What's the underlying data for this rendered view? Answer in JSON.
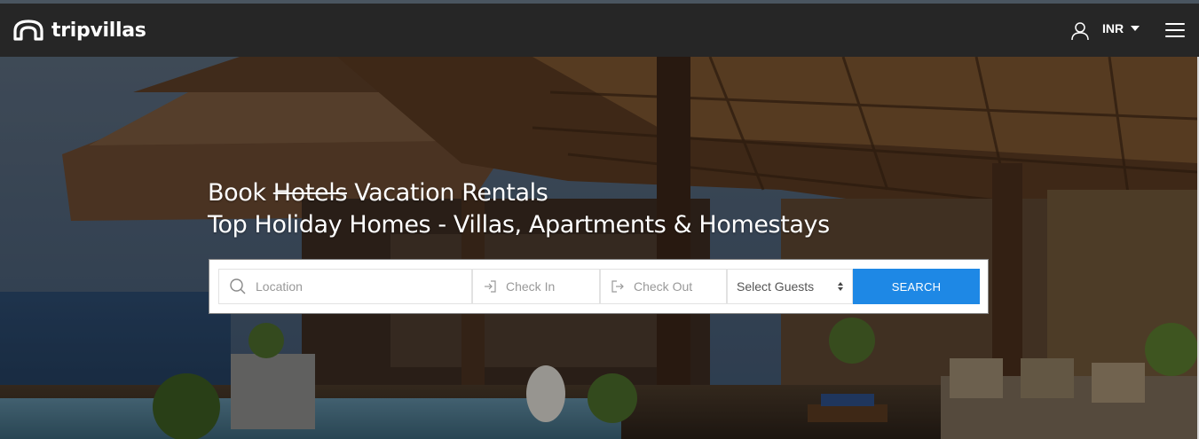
{
  "header": {
    "brand": "tripvillas",
    "currency": "INR"
  },
  "hero": {
    "headline": {
      "book": "Book",
      "struck": "Hotels",
      "rest": "Vacation Rentals"
    },
    "subheadline": "Top Holiday Homes - Villas, Apartments & Homestays"
  },
  "search": {
    "location_placeholder": "Location",
    "checkin_placeholder": "Check In",
    "checkout_placeholder": "Check Out",
    "guests_selected": "Select Guests",
    "button_label": "SEARCH"
  },
  "colors": {
    "navbar": "#262626",
    "accent": "#1e88e5"
  }
}
